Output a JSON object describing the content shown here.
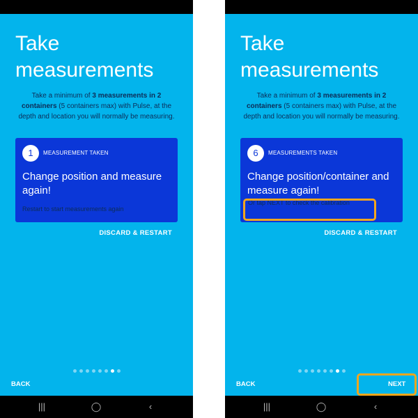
{
  "left": {
    "title": "Take\nmeasurements",
    "desc": {
      "pre": "Take a minimum of ",
      "bold1": "3 measurements in 2 containers",
      "mid": " (5 containers max) with Pulse, at the depth and location you will normally be measuring."
    },
    "card": {
      "count": "1",
      "label": "MEASUREMENT TAKEN",
      "heading": "Change position and measure again!",
      "sub": "Restart to start measurements again"
    },
    "discard": "DISCARD & RESTART",
    "back": "BACK"
  },
  "right": {
    "title": "Take\nmeasurements",
    "desc": {
      "pre": "Take a minimum of ",
      "bold1": "3 measurements in 2 containers",
      "mid": " (5 containers max) with Pulse, at the depth and location you will normally be measuring."
    },
    "card": {
      "count": "6",
      "label": "MEASUREMENTS TAKEN",
      "heading": "Change position/container and measure again!",
      "sub": "Or tap NEXT to check the calibration"
    },
    "discard": "DISCARD & RESTART",
    "back": "BACK",
    "next": "NEXT"
  },
  "pager": {
    "total": 8,
    "active_index": 6
  },
  "nav": {
    "recent": "|||",
    "home": "◯",
    "back": "‹"
  },
  "colors": {
    "background": "#03b4ec",
    "card": "#0b37d8",
    "highlight": "#f4a61d"
  }
}
